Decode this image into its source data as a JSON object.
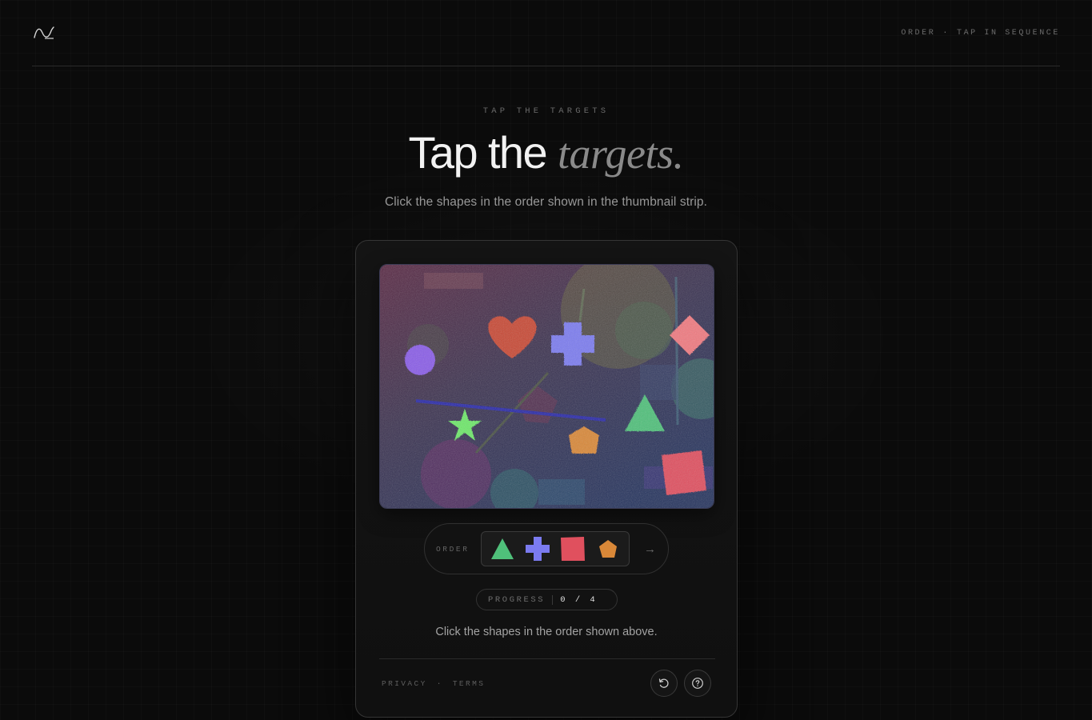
{
  "header": {
    "logo_icon": "wave-logo-icon",
    "meta_left": "ORDER",
    "meta_sep": "·",
    "meta_right": "TAP IN SEQUENCE"
  },
  "hero": {
    "eyebrow": "TAP THE TARGETS",
    "title_plain": "Tap the",
    "title_emphasis": "targets.",
    "subtitle": "Click the shapes in the order shown in the thumbnail strip."
  },
  "challenge": {
    "canvas_shapes": [
      "circle",
      "heart",
      "cross",
      "diamond",
      "star",
      "pentagon",
      "triangle",
      "square"
    ],
    "order": {
      "label": "ORDER",
      "sequence": [
        "triangle",
        "cross",
        "square",
        "pentagon"
      ],
      "next_icon": "arrow-right-icon",
      "next_glyph": "→"
    },
    "progress": {
      "label": "PROGRESS",
      "value": "0 / 4"
    },
    "instruction": "Click the shapes in the order shown above.",
    "footer": {
      "privacy": "PRIVACY",
      "sep": "·",
      "terms": "TERMS"
    },
    "buttons": {
      "refresh_icon": "refresh-icon",
      "help_icon": "help-circle-icon"
    }
  },
  "colors": {
    "triangle": "#4fc07a",
    "cross": "#7b7bf0",
    "square": "#e0505e",
    "pentagon": "#d98838",
    "star": "#6ee86a",
    "circle": "#8a5de8",
    "heart": "#c84a35",
    "diamond": "#f07a80"
  }
}
